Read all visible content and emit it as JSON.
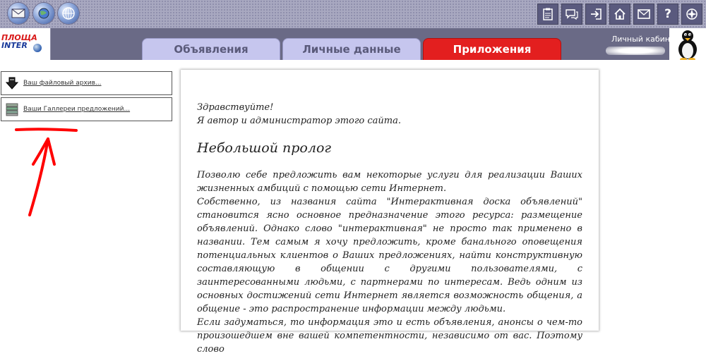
{
  "top_icons_left": [
    "mail-icon",
    "earth-mail-icon",
    "globe-icon"
  ],
  "top_icons_right": [
    "clipboard-icon",
    "chat-icon",
    "login-icon",
    "home-icon",
    "envelope-icon",
    "help-icon",
    "compass-icon"
  ],
  "help_glyph": "?",
  "logo": {
    "line1": "ПЛОЩА",
    "line2": "INTER"
  },
  "tabs": [
    {
      "label": "Объявления"
    },
    {
      "label": "Личные данные"
    },
    {
      "label": "Приложения"
    }
  ],
  "colors": {
    "active_tab": "#e31f1f",
    "inactive_tab": "#c6c6ee",
    "band": "#6a6a86",
    "annotation": "#ff0000"
  },
  "cabinet": {
    "label": "Личный кабинет"
  },
  "left_links": [
    {
      "label": "Ваш файловый архив...",
      "icon": "archive-download-icon"
    },
    {
      "label": "Ваши Галлереи предложений...",
      "icon": "gallery-stack-icon"
    }
  ],
  "article": {
    "greeting_1": "Здравствуйте!",
    "greeting_2": "Я автор и администратор этого сайта.",
    "heading": "Небольшой пролог",
    "paragraph_1": "Позволю себе предложить вам некоторые услуги для реализации Ваших жизненных амбиций с помощью сети Интернет.",
    "paragraph_2": "Собственно, из названия сайта \"Интерактивная доска объявлений\" становится ясно основное предназначение этого ресурса: размещение объявлений. Однако слово \"интерактивная\" не просто так применено в названии. Тем самым я хочу предложить, кроме банального оповещения потенциальных клиентов о Ваших предложениях, найти конструктивную составляющую в общении с другими пользователями, с заинтересованными людьми, с партнерами по интересам. Ведь одним из основных достижений сети Интернет является возможность общения, а общение - это распространение информации между людьми.",
    "paragraph_3": "Если задуматься, то информация это и есть объявления, анонсы о чем-то произошедшем вне вашей компетентности, независимо от вас. Поэтому слово"
  }
}
